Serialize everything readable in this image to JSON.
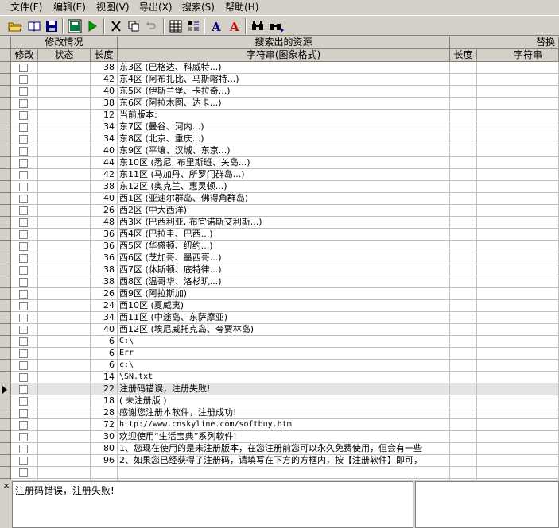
{
  "menu": [
    "文件(F)",
    "编辑(E)",
    "视图(V)",
    "导出(X)",
    "搜索(S)",
    "帮助(H)"
  ],
  "header": {
    "group1": "修改情况",
    "group2": "搜索出的资源",
    "group3": "替换",
    "col_modify": "修改",
    "col_status": "状态",
    "col_len": "长度",
    "col_string": "字符串(图象格式)",
    "col_len2": "长度",
    "col_string2": "字符串"
  },
  "rows": [
    {
      "len": "38",
      "text": "东3区      (巴格达、科威特...)"
    },
    {
      "len": "42",
      "text": "东4区      (阿布扎比、马斯喀特...)"
    },
    {
      "len": "40",
      "text": "东5区      (伊斯兰堡、卡拉奇...)"
    },
    {
      "len": "38",
      "text": "东6区      (阿拉木图、达卡...)"
    },
    {
      "len": "12",
      "text": "当前版本:"
    },
    {
      "len": "34",
      "text": "东7区      (曼谷、河内...)"
    },
    {
      "len": "34",
      "text": "东8区      (北京、重庆...)"
    },
    {
      "len": "40",
      "text": "东9区      (平壤、汉城、东京...)"
    },
    {
      "len": "44",
      "text": "东10区     (悉尼, 布里斯班、关岛...)"
    },
    {
      "len": "42",
      "text": "东11区     (马加丹、所罗门群岛...)"
    },
    {
      "len": "38",
      "text": "东12区     (奥克兰、惠灵顿...)"
    },
    {
      "len": "40",
      "text": "西1区      (亚速尔群岛、佛得角群岛)"
    },
    {
      "len": "26",
      "text": "西2区      (中大西洋)"
    },
    {
      "len": "48",
      "text": "西3区      (巴西利亚, 布宜诺斯艾利斯...)"
    },
    {
      "len": "36",
      "text": "西4区      (巴拉圭、巴西...)"
    },
    {
      "len": "36",
      "text": "西5区      (华盛顿、纽约...)"
    },
    {
      "len": "36",
      "text": "西6区      (芝加哥、墨西哥...)"
    },
    {
      "len": "38",
      "text": "西7区      (休斯顿、底特律...)"
    },
    {
      "len": "38",
      "text": "西8区      (温哥华、洛杉玑...)"
    },
    {
      "len": "26",
      "text": "西9区      (阿拉斯加)"
    },
    {
      "len": "24",
      "text": "西10区     (夏威夷)"
    },
    {
      "len": "34",
      "text": "西11区     (中途岛、东萨摩亚)"
    },
    {
      "len": "40",
      "text": "西12区     (埃尼威托克岛、夸贾林岛)"
    },
    {
      "len": "6",
      "text": "C:\\"
    },
    {
      "len": "6",
      "text": "Err"
    },
    {
      "len": "6",
      "text": "c:\\"
    },
    {
      "len": "14",
      "text": "\\SN.txt"
    },
    {
      "len": "22",
      "text": "注册码错误，注册失败!",
      "selected": true
    },
    {
      "len": "18",
      "text": " ( 未注册版 )"
    },
    {
      "len": "28",
      "text": "感谢您注册本软件，注册成功!"
    },
    {
      "len": "72",
      "text": "http://www.cnskyline.com/softbuy.htm"
    },
    {
      "len": "30",
      "text": "欢迎使用“生活宝典”系列软件!"
    },
    {
      "len": "80",
      "text": "1、您现在使用的是未注册版本，在您注册前您可以永久免费使用，但会有一些"
    },
    {
      "len": "96",
      "text": "2、如果您已经获得了注册码，请填写在下方的方框内，按【注册软件】即可，"
    },
    {
      "len": "",
      "text": ""
    },
    {
      "len": "",
      "text": ""
    }
  ],
  "edit_text": "注册码错误，注册失败!",
  "close_symbol": "×"
}
